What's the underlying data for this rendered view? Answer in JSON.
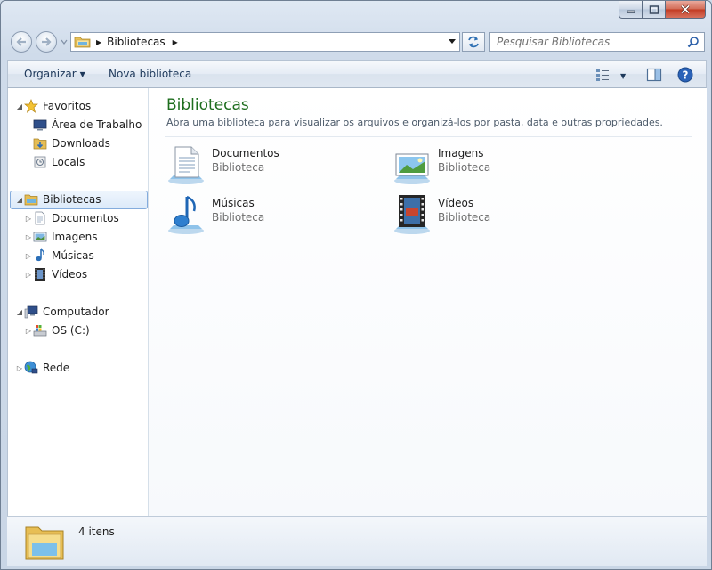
{
  "window": {
    "caption_buttons": [
      "minimize-icon",
      "maximize-icon",
      "close-icon"
    ]
  },
  "address_bar": {
    "location": "Bibliotecas",
    "search_placeholder": "Pesquisar Bibliotecas"
  },
  "toolbar": {
    "organize_label": "Organizar",
    "new_library_label": "Nova biblioteca"
  },
  "nav_pane": {
    "favorites": "Favoritos",
    "desktop": "Área de Trabalho",
    "downloads": "Downloads",
    "places": "Locais",
    "libraries": "Bibliotecas",
    "documents": "Documentos",
    "images": "Imagens",
    "music": "Músicas",
    "videos": "Vídeos",
    "computer": "Computador",
    "drive_c": "OS (C:)",
    "network": "Rede"
  },
  "main": {
    "title": "Bibliotecas",
    "description": "Abra uma biblioteca para visualizar os arquivos e organizá-los por pasta, data e outras propriedades.",
    "libraries": [
      {
        "name": "Documentos",
        "type": "Biblioteca",
        "icon": "documents-library-icon"
      },
      {
        "name": "Imagens",
        "type": "Biblioteca",
        "icon": "pictures-library-icon"
      },
      {
        "name": "Músicas",
        "type": "Biblioteca",
        "icon": "music-library-icon"
      },
      {
        "name": "Vídeos",
        "type": "Biblioteca",
        "icon": "videos-library-icon"
      }
    ]
  },
  "details_pane": {
    "count": "4 itens"
  },
  "colors": {
    "title_green": "#1e6e1e",
    "selection_border": "#84acdd",
    "close_red": "#c23a22"
  }
}
